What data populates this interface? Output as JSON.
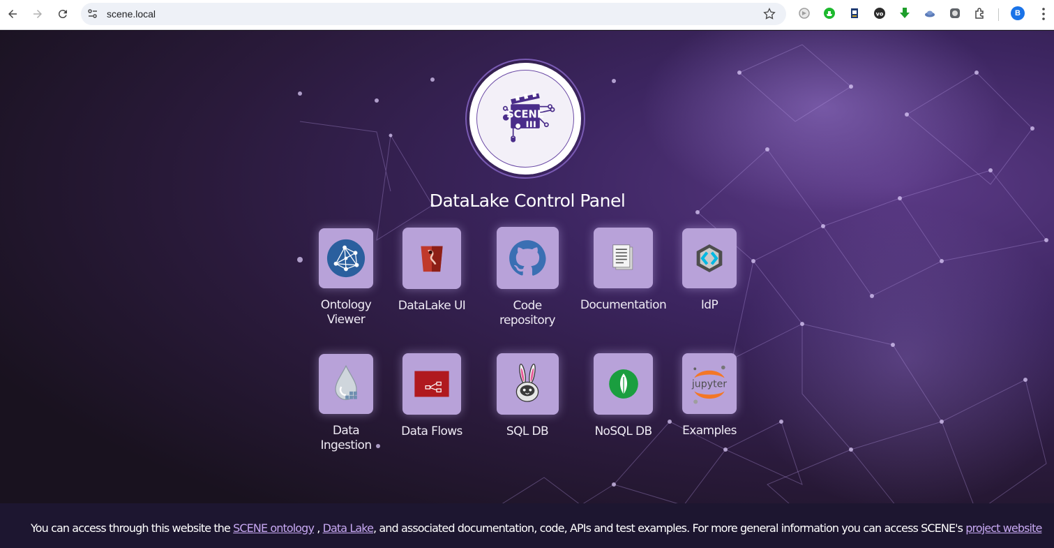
{
  "browser": {
    "url": "scene.local",
    "profile_initial": "B",
    "extensions": [
      "gray-circle-ext-icon",
      "green-shield-ext-icon",
      "bookmark-ext-icon",
      "vo-ext-icon",
      "green-download-ext-icon",
      "cloud-ext-icon",
      "gray-square-ext-icon",
      "puzzle-extensions-icon"
    ]
  },
  "page": {
    "title": "DataLake Control Panel",
    "logo_text": "SCENE",
    "tiles_row1": [
      {
        "label_line1": "Ontology",
        "label_line2": "Viewer",
        "icon": "network-graph-icon"
      },
      {
        "label_line1": "DataLake UI",
        "label_line2": "",
        "icon": "aws-s3-bucket-icon"
      },
      {
        "label_line1": "Code",
        "label_line2": "repository",
        "icon": "github-icon"
      },
      {
        "label_line1": "Documentation",
        "label_line2": "",
        "icon": "document-icon"
      },
      {
        "label_line1": "IdP",
        "label_line2": "",
        "icon": "keycloak-icon"
      }
    ],
    "tiles_row2": [
      {
        "label_line1": "Data",
        "label_line2": "Ingestion",
        "icon": "data-drop-icon"
      },
      {
        "label_line1": "Data Flows",
        "label_line2": "",
        "icon": "nifi-flow-icon"
      },
      {
        "label_line1": "SQL DB",
        "label_line2": "",
        "icon": "bunny-astronaut-icon"
      },
      {
        "label_line1": "NoSQL DB",
        "label_line2": "",
        "icon": "mongodb-leaf-icon"
      },
      {
        "label_line1": "Examples",
        "label_line2": "",
        "icon": "jupyter-icon"
      }
    ]
  },
  "footer": {
    "text_1": "You can access through this website the ",
    "link_ontology": "SCENE ontology",
    "text_2": " , ",
    "link_datalake": "Data Lake",
    "text_3": ", and associated documentation, code, APIs and test examples. For more general information you can access SCENE's ",
    "link_project": "project website"
  },
  "colors": {
    "tile_bg": "#b8a2d9",
    "logo_purple": "#4a2d8a",
    "link": "#c7a8f2"
  }
}
